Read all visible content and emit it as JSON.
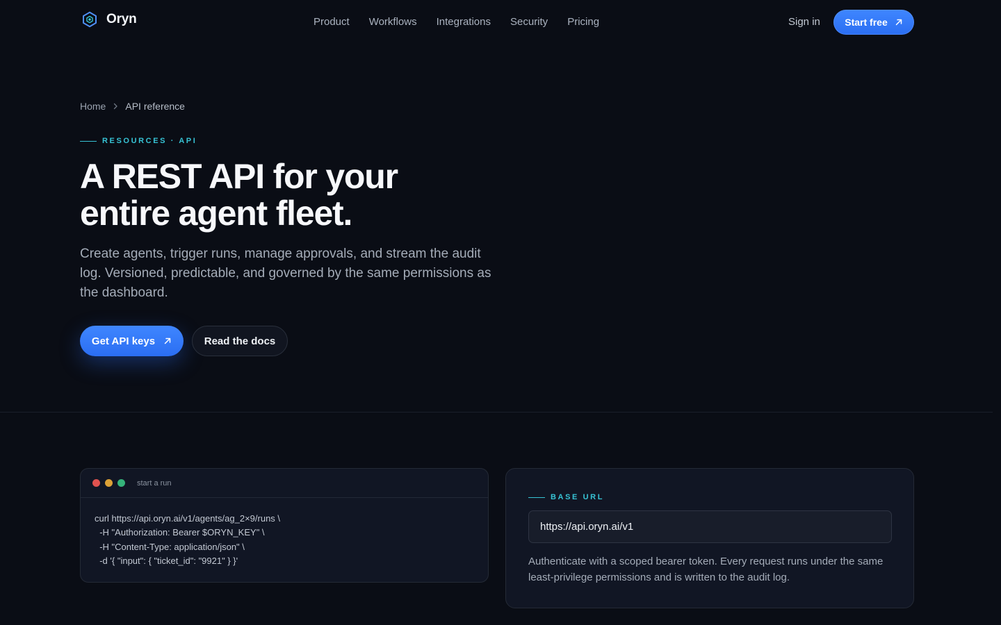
{
  "header": {
    "brand": "Oryn",
    "nav": [
      "Product",
      "Workflows",
      "Integrations",
      "Security",
      "Pricing"
    ],
    "sign_in": "Sign in",
    "start_free": "Start free"
  },
  "breadcrumb": {
    "home": "Home",
    "current": "API reference"
  },
  "hero": {
    "eyebrow": "RESOURCES · API",
    "title_line1": "A REST API for your",
    "title_line2": "entire agent fleet.",
    "lede": "Create agents, trigger runs, manage approvals, and stream the audit log. Versioned, predictable, and governed by the same permissions as the dashboard.",
    "primary_cta": "Get API keys",
    "secondary_cta": "Read the docs"
  },
  "code_card": {
    "title": "start a run",
    "lines": [
      "curl https://api.oryn.ai/v1/agents/ag_2×9/runs \\",
      "  -H \"Authorization: Bearer $ORYN_KEY\" \\",
      "  -H \"Content-Type: application/json\" \\",
      "  -d '{ \"input\": { \"ticket_id\": \"9921\" } }'"
    ],
    "window_dots": [
      "#e0524f",
      "#dca136",
      "#35b37a"
    ]
  },
  "base_url_card": {
    "eyebrow": "BASE URL",
    "url": "https://api.oryn.ai/v1",
    "description": "Authenticate with a scoped bearer token. Every request runs under the same least-privilege permissions and is written to the audit log."
  },
  "colors": {
    "background": "#0a0d15",
    "accent_blue": "#2f76fb",
    "accent_cyan": "#37c3d5",
    "card": "#111624"
  },
  "icons": {
    "logo": "hexagon-logo-icon",
    "arrow": "arrow-up-right-icon",
    "breadcrumb_separator": "chevron-right-icon"
  }
}
